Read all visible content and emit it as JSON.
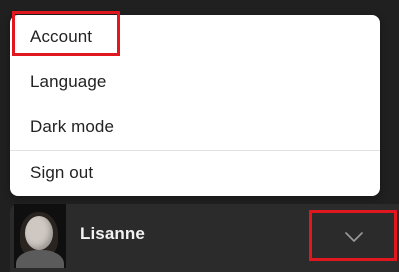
{
  "menu": {
    "items": [
      {
        "label": "Account"
      },
      {
        "label": "Language"
      },
      {
        "label": "Dark mode"
      },
      {
        "label": "Sign out"
      }
    ]
  },
  "user": {
    "name": "Lisanne"
  },
  "colors": {
    "menu_bg": "#ffffff",
    "page_bg": "#202020",
    "user_bar_bg": "#2b2b2b",
    "highlight": "#e0171f",
    "menu_text": "#222222",
    "user_text": "#f2f2f2"
  },
  "icons": {
    "expand": "chevron-down-icon",
    "avatar": "user-avatar"
  }
}
